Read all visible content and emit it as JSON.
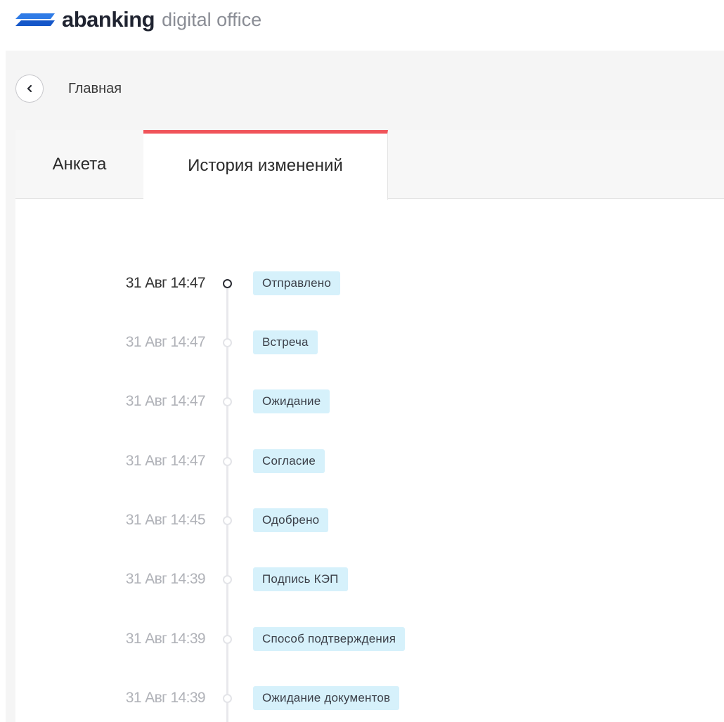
{
  "header": {
    "brand": "abanking",
    "subtitle": "digital office"
  },
  "nav": {
    "breadcrumb": "Главная"
  },
  "tabs": [
    {
      "label": "Анкета",
      "active": false
    },
    {
      "label": "История изменений",
      "active": true
    }
  ],
  "timeline": [
    {
      "date": "31 Авг 14:47",
      "status": "Отправлено",
      "active": true
    },
    {
      "date": "31 Авг 14:47",
      "status": "Встреча",
      "active": false
    },
    {
      "date": "31 Авг 14:47",
      "status": "Ожидание",
      "active": false
    },
    {
      "date": "31 Авг 14:47",
      "status": "Согласие",
      "active": false
    },
    {
      "date": "31 Авг 14:45",
      "status": "Одобрено",
      "active": false
    },
    {
      "date": "31 Авг 14:39",
      "status": "Подпись КЭП",
      "active": false
    },
    {
      "date": "31 Авг 14:39",
      "status": "Способ подтверждения",
      "active": false
    },
    {
      "date": "31 Авг 14:39",
      "status": "Ожидание документов",
      "active": false
    }
  ],
  "colors": {
    "accent_tab": "#f0545a",
    "badge_bg": "#d6f1fb",
    "logo_blue": "#2f7be6"
  },
  "icons": {
    "logo": "abanking-logo-icon",
    "back": "chevron-left-icon"
  }
}
